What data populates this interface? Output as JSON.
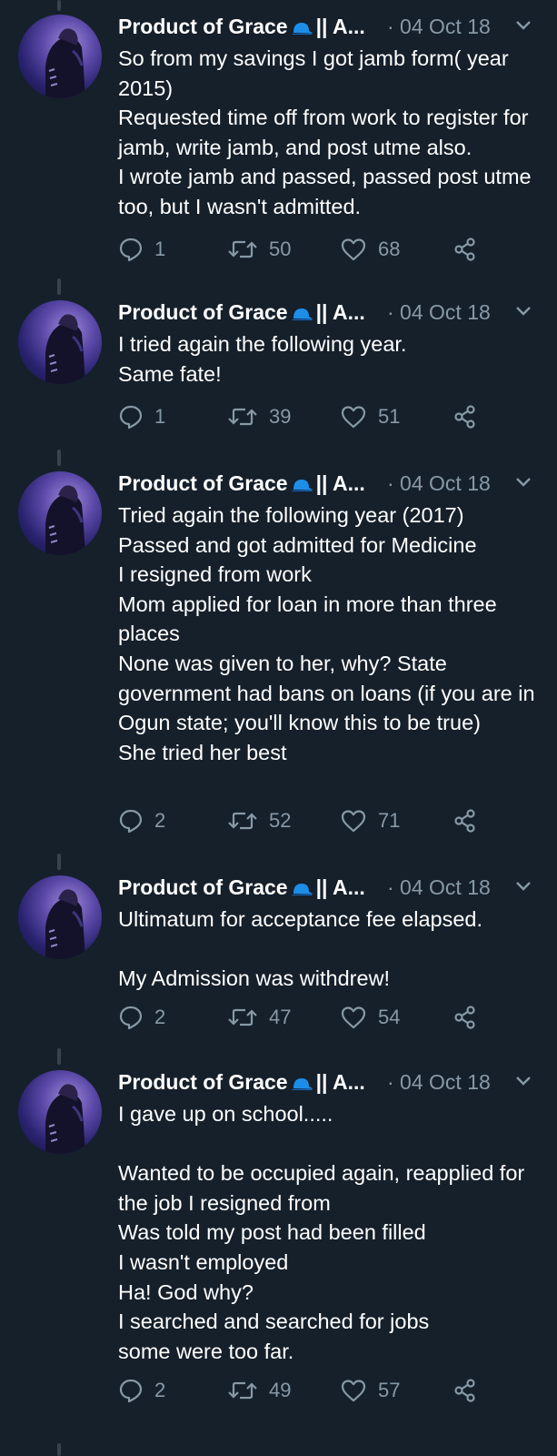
{
  "app": {
    "name": "Twitter thread"
  },
  "tweets": [
    {
      "author_name": "Product of Grace",
      "author_suffix": "|| A...",
      "date": "· 04 Oct 18",
      "text": "So from my savings I got jamb form( year 2015)\nRequested time off from work to register for jamb, write jamb, and post utme also.\nI wrote jamb and passed, passed post utme too, but I wasn't admitted.",
      "replies": "1",
      "retweets": "50",
      "likes": "68"
    },
    {
      "author_name": "Product of Grace",
      "author_suffix": "|| A...",
      "date": "· 04 Oct 18",
      "text": "I tried again the following year.\nSame fate!",
      "replies": "1",
      "retweets": "39",
      "likes": "51"
    },
    {
      "author_name": "Product of Grace",
      "author_suffix": "|| A...",
      "date": "· 04 Oct 18",
      "text": "Tried again the following year (2017)\nPassed and got admitted for Medicine\nI resigned from work\nMom applied for loan in more than three places\nNone was given to her, why? State government had bans on loans (if you are in Ogun state; you'll know this to be true)\nShe tried her best",
      "replies": "2",
      "retweets": "52",
      "likes": "71"
    },
    {
      "author_name": "Product of Grace",
      "author_suffix": "|| A...",
      "date": "· 04 Oct 18",
      "text": "Ultimatum for acceptance fee elapsed.\n\nMy Admission was withdrew!",
      "replies": "2",
      "retweets": "47",
      "likes": "54"
    },
    {
      "author_name": "Product of Grace",
      "author_suffix": "|| A...",
      "date": "· 04 Oct 18",
      "text": "I gave up on school.....\n\nWanted to be occupied again, reapplied for the job I resigned from\nWas told my post had been filled\nI wasn't employed\nHa! God why?\nI searched and searched for jobs\nsome were too far.",
      "replies": "2",
      "retweets": "49",
      "likes": "57"
    }
  ],
  "icons": {
    "reply": "reply-icon",
    "retweet": "retweet-icon",
    "like": "heart-icon",
    "share": "share-icon",
    "caret": "chevron-down-icon",
    "emoji": "blue-cap-emoji"
  },
  "colors": {
    "background": "#15202b",
    "text": "#ffffff",
    "secondary": "#8899a6",
    "thread_line": "#38444d",
    "emoji_blue": "#1d8ee8"
  }
}
